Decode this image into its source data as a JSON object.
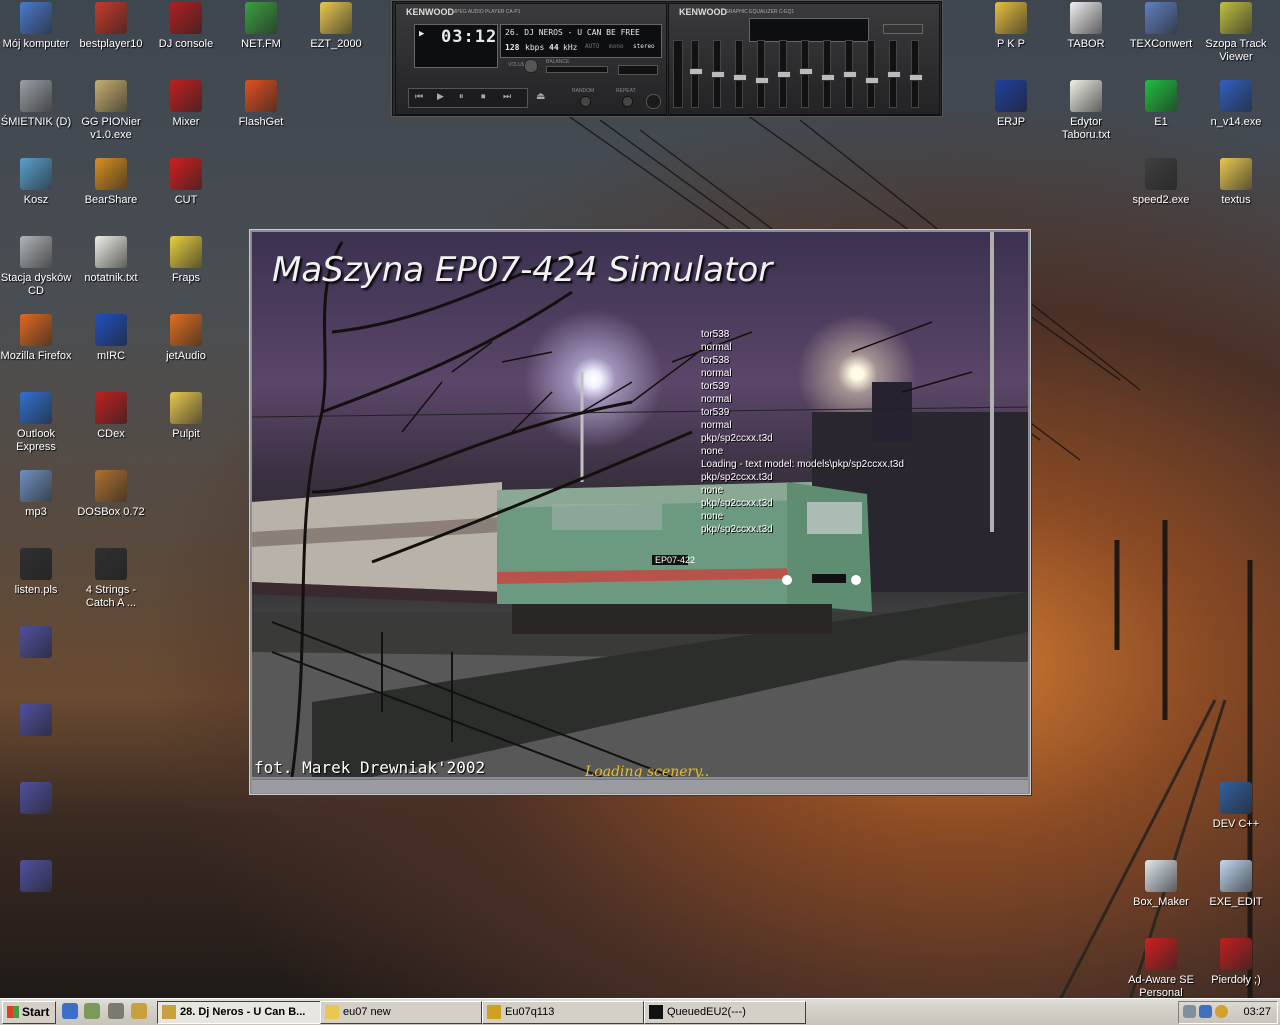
{
  "desktop": {
    "icons_left": [
      {
        "label": "Mój komputer",
        "icon": "my-computer-icon",
        "color": "#4a7acf"
      },
      {
        "label": "bestplayer10",
        "icon": "bestplayer-icon",
        "color": "#c83a2a"
      },
      {
        "label": "DJ console",
        "icon": "dj-console-icon",
        "color": "#b02020"
      },
      {
        "label": "NET.FM",
        "icon": "netfm-icon",
        "color": "#3aa040"
      },
      {
        "label": "EZT_2000",
        "icon": "folder-icon",
        "color": "#e8c850"
      },
      {
        "label": "ŚMIETNIK (D)",
        "icon": "drive-icon",
        "color": "#9aa0a6"
      },
      {
        "label": "GG PIONier v1.0.exe",
        "icon": "gg-icon",
        "color": "#c8b070"
      },
      {
        "label": "Mixer",
        "icon": "mixer-icon",
        "color": "#c02020"
      },
      {
        "label": "FlashGet",
        "icon": "flashget-icon",
        "color": "#e05020"
      },
      {
        "label": "Kosz",
        "icon": "recycle-bin-icon",
        "color": "#5aa0d0"
      },
      {
        "label": "BearShare",
        "icon": "bearshare-icon",
        "color": "#d89020"
      },
      {
        "label": "CUT",
        "icon": "cut-icon",
        "color": "#d02020"
      },
      {
        "label": "Stacja dysków CD",
        "icon": "cd-drive-icon",
        "color": "#b0b4b8"
      },
      {
        "label": "notatnik.txt",
        "icon": "text-file-icon",
        "color": "#f0f0e8"
      },
      {
        "label": "Fraps",
        "icon": "fraps-icon",
        "color": "#e8d040"
      },
      {
        "label": "Mozilla Firefox",
        "icon": "firefox-icon",
        "color": "#e06a20"
      },
      {
        "label": "mIRC",
        "icon": "mirc-icon",
        "color": "#2050c0"
      },
      {
        "label": "jetAudio",
        "icon": "jetaudio-icon",
        "color": "#e07020"
      },
      {
        "label": "Outlook Express",
        "icon": "outlook-icon",
        "color": "#3070d0"
      },
      {
        "label": "CDex",
        "icon": "cdex-icon",
        "color": "#c02020"
      },
      {
        "label": "Pulpit",
        "icon": "folder-icon",
        "color": "#e8c850"
      },
      {
        "label": "mp3",
        "icon": "media-icon",
        "color": "#7090c0"
      },
      {
        "label": "DOSBox 0.72",
        "icon": "dosbox-icon",
        "color": "#b07030"
      },
      {
        "label": "listen.pls",
        "icon": "playlist-icon",
        "color": "#303030"
      },
      {
        "label": "4 Strings - Catch A ...",
        "icon": "speaker-icon",
        "color": "#303030"
      },
      {
        "label": "",
        "icon": "winrar-icon",
        "color": "#5050a0"
      },
      {
        "label": "",
        "icon": "winrar-icon",
        "color": "#5050a0"
      },
      {
        "label": "",
        "icon": "winrar-icon",
        "color": "#5050a0"
      },
      {
        "label": "",
        "icon": "winrar-icon",
        "color": "#5050a0"
      }
    ],
    "icons_right": [
      {
        "label": "P K P",
        "icon": "pkp-icon",
        "color": "#e8c040"
      },
      {
        "label": "TABOR",
        "icon": "tabor-icon",
        "color": "#f0f0f0"
      },
      {
        "label": "TEXConwert",
        "icon": "texconwert-icon",
        "color": "#6080c0"
      },
      {
        "label": "Szopa Track Viewer",
        "icon": "track-viewer-icon",
        "color": "#c0c040"
      },
      {
        "label": "ERJP",
        "icon": "erjp-icon",
        "color": "#2040a0"
      },
      {
        "label": "Edytor Taboru.txt",
        "icon": "text-file-icon",
        "color": "#f0f0e8"
      },
      {
        "label": "E1",
        "icon": "e1-icon",
        "color": "#20c040"
      },
      {
        "label": "n_v14.exe",
        "icon": "flash-icon",
        "color": "#3060c0"
      },
      {
        "label": "speed2.exe",
        "icon": "nfs-icon",
        "color": "#404040"
      },
      {
        "label": "textus",
        "icon": "folder-icon",
        "color": "#e8c850"
      },
      {
        "label": "DEV C++",
        "icon": "devcpp-icon",
        "color": "#3060a0"
      },
      {
        "label": "Box_Maker",
        "icon": "box-maker-icon",
        "color": "#e0e8f0"
      },
      {
        "label": "EXE_EDIT",
        "icon": "exe-edit-icon",
        "color": "#c0d8f0"
      },
      {
        "label": "Ad-Aware SE Personal",
        "icon": "adaware-icon",
        "color": "#d02020"
      },
      {
        "label": "Pierdoły ;)",
        "icon": "help-icon",
        "color": "#c02020"
      }
    ]
  },
  "player": {
    "brand_left": "KENWOOD",
    "subtitle_left": "MPEG AUDIO PLAYER CA-P1",
    "time": "03:12",
    "track": "26. DJ NEROS - U CAN BE FREE",
    "bitrate": "128",
    "bitrate_unit": "kbps",
    "samplerate": "44",
    "samplerate_unit": "kHz",
    "mode_auto": "AUTO",
    "mode_mono": "mono",
    "mode_stereo": "stereo",
    "volume_label": "VOLUME",
    "balance_label": "BALANCE",
    "random_label": "RANDOM",
    "repeat_label": "REPEAT",
    "brand_right": "KENWOOD",
    "subtitle_right": "GRAPHIC EQUALIZER C-EQ1",
    "eq_levels": [
      0.55,
      0.5,
      0.45,
      0.4,
      0.5,
      0.55,
      0.45,
      0.5,
      0.4,
      0.5,
      0.45
    ]
  },
  "splash": {
    "title": "MaSzyna EP07-424 Simulator",
    "log_lines": [
      "tor538",
      "normal",
      "tor538",
      "normal",
      "tor539",
      "normal",
      "tor539",
      "normal",
      "pkp/sp2ccxx.t3d",
      "none",
      "Loading - text model: models\\pkp/sp2ccxx.t3d",
      "pkp/sp2ccxx.t3d",
      "none",
      "pkp/sp2ccxx.t3d",
      "none",
      "pkp/sp2ccxx.t3d"
    ],
    "photo_credit": "fot. Marek Drewniak'2002",
    "loading_text": "Loading scenery..",
    "locomotive_number": "EP07-422",
    "progress": 0
  },
  "taskbar": {
    "start_label": "Start",
    "tasks": [
      {
        "label": "28. Dj Neros - U Can B...",
        "icon": "winamp-icon",
        "active": true
      },
      {
        "label": "eu07 new",
        "icon": "folder-icon",
        "active": false
      },
      {
        "label": "Eu07q113",
        "icon": "train-icon",
        "active": false
      },
      {
        "label": "QueuedEU2(---)",
        "icon": "console-icon",
        "active": false
      }
    ],
    "clock": "03:27"
  }
}
